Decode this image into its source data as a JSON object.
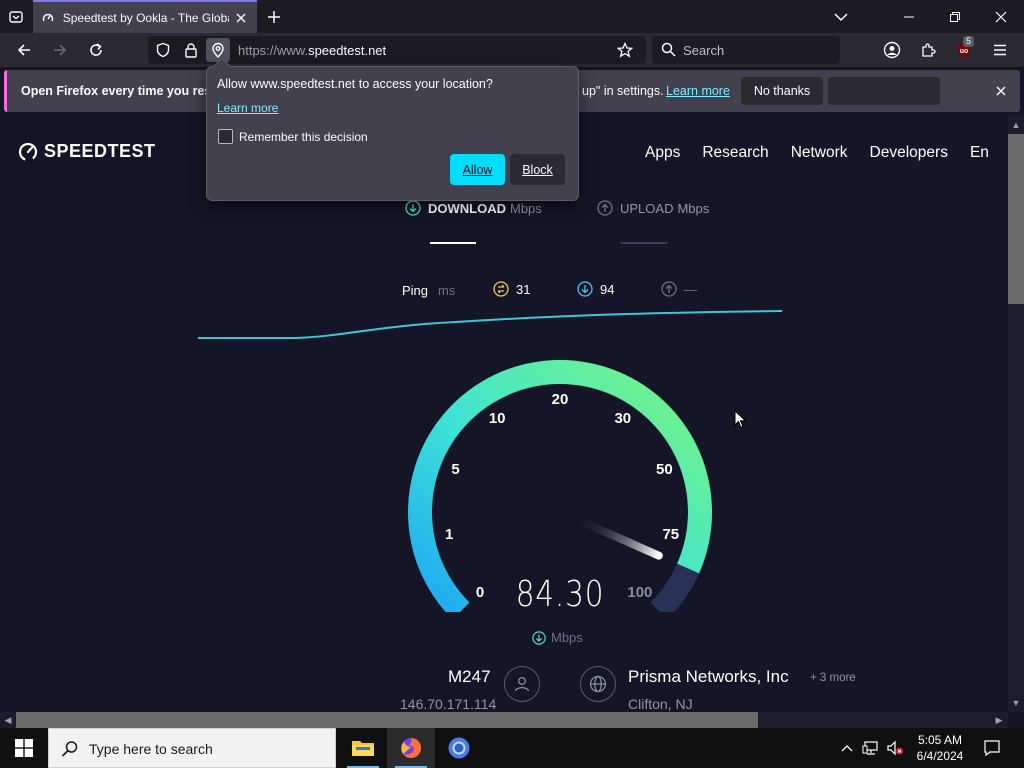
{
  "browser": {
    "tab_title": "Speedtest by Ookla - The Global",
    "url_host_prefix": "https://www.",
    "url_host": "speedtest.net",
    "search_placeholder": "Search",
    "extension_badge": "5"
  },
  "notification": {
    "text": "Open Firefox every time you rest",
    "text_right": "up\" in settings.",
    "learn_more": "Learn more",
    "no_thanks": "No thanks"
  },
  "permission_popup": {
    "title": "Allow www.speedtest.net to access your location?",
    "learn_more": "Learn more",
    "remember_label": "Remember this decision",
    "remember_checked": false,
    "allow_label": "Allow",
    "block_label": "Block"
  },
  "site": {
    "logo_text": "SPEEDTEST",
    "nav": [
      "Apps",
      "Research",
      "Network",
      "Developers",
      "En"
    ]
  },
  "test": {
    "download_label": "DOWNLOAD",
    "upload_label": "UPLOAD",
    "unit_label": "Mbps",
    "ping_label": "Ping",
    "ping_unit": "ms",
    "ping_idle": "31",
    "ping_download": "94",
    "ping_upload": "—",
    "speed_value": "84.30",
    "speed_unit": "Mbps",
    "gauge_value": 84.3,
    "gauge_ticks": [
      "0",
      "1",
      "5",
      "10",
      "20",
      "30",
      "50",
      "75",
      "100"
    ]
  },
  "connection": {
    "isp": "M247",
    "ip": "146.70.171.114",
    "server": "Prisma Networks, Inc",
    "server_more": "+ 3 more",
    "server_location": "Clifton, NJ"
  },
  "taskbar": {
    "search_placeholder": "Type here to search",
    "time": "5:05 AM",
    "date": "6/4/2024"
  },
  "colors": {
    "page_bg": "#141526",
    "accent_cyan": "#00ddff",
    "gauge_start": "#1eb4f5",
    "gauge_end": "#6cf58a"
  }
}
